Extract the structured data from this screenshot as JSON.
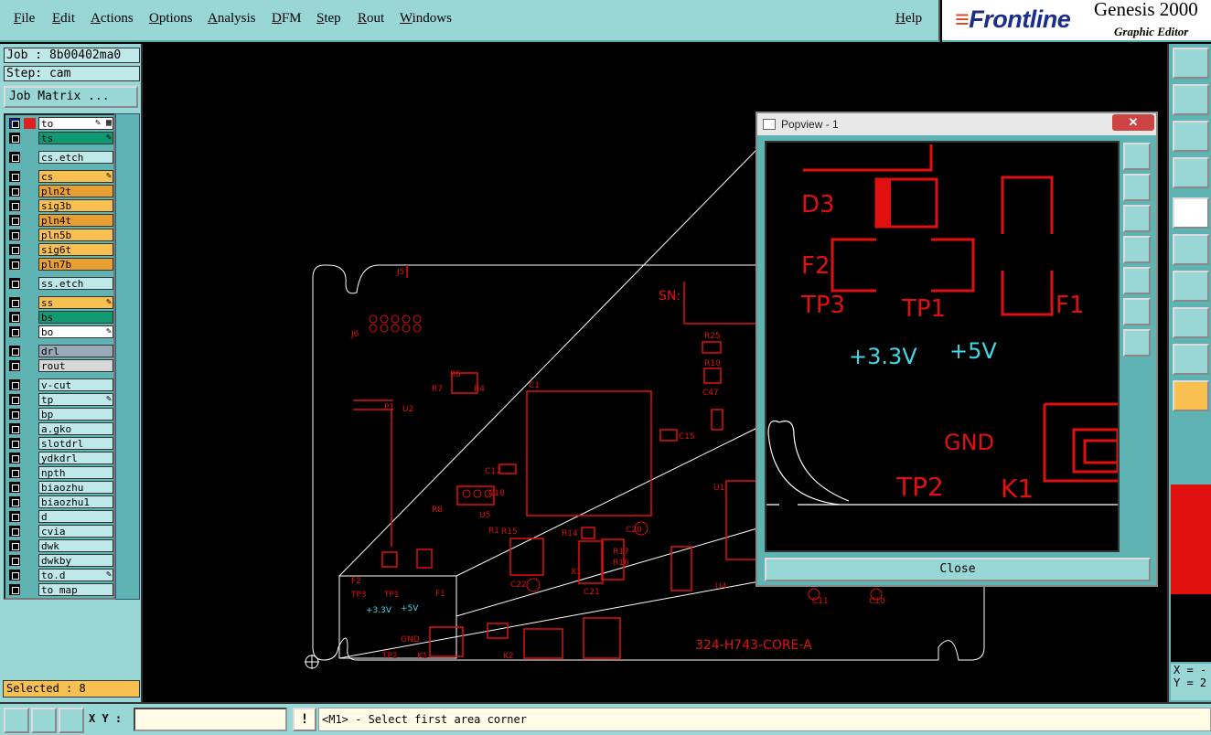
{
  "menubar": {
    "items": [
      "File",
      "Edit",
      "Actions",
      "Options",
      "Analysis",
      "DFM",
      "Step",
      "Rout",
      "Windows"
    ],
    "help": "Help"
  },
  "logo": {
    "brand": "Frontline",
    "product": "Genesis 2000",
    "subtitle": "Graphic Editor"
  },
  "job": {
    "job_line": "Job : 8b00402ma0",
    "step_line": "Step: cam",
    "matrix_button": "Job Matrix ..."
  },
  "layers": [
    {
      "name": "to",
      "color": "#ffffff",
      "flag": "✎ ▦"
    },
    {
      "name": "ts",
      "color": "#0f9a74",
      "flag": "✎"
    },
    {
      "name": "cs.etch",
      "color": "#bfe8e8",
      "flag": ""
    },
    {
      "name": "cs",
      "color": "#f8c050",
      "flag": "✎"
    },
    {
      "name": "pln2t",
      "color": "#e8a030",
      "flag": ""
    },
    {
      "name": "sig3b",
      "color": "#f8c050",
      "flag": ""
    },
    {
      "name": "pln4t",
      "color": "#e8a030",
      "flag": ""
    },
    {
      "name": "pln5b",
      "color": "#f8c050",
      "flag": ""
    },
    {
      "name": "sig6t",
      "color": "#f8c050",
      "flag": ""
    },
    {
      "name": "pln7b",
      "color": "#e8a030",
      "flag": ""
    },
    {
      "name": "ss.etch",
      "color": "#bfe8e8",
      "flag": ""
    },
    {
      "name": "ss",
      "color": "#f8c050",
      "flag": "✎"
    },
    {
      "name": "bs",
      "color": "#0f9a74",
      "flag": ""
    },
    {
      "name": "bo",
      "color": "#ffffff",
      "flag": "✎"
    },
    {
      "name": "drl",
      "color": "#9aa8b8",
      "flag": ""
    },
    {
      "name": "rout",
      "color": "#d8d8d8",
      "flag": ""
    },
    {
      "name": "v-cut",
      "color": "#bfe8e8",
      "flag": ""
    },
    {
      "name": "tp",
      "color": "#bfe8e8",
      "flag": "✎"
    },
    {
      "name": "bp",
      "color": "#bfe8e8",
      "flag": ""
    },
    {
      "name": "a.gko",
      "color": "#bfe8e8",
      "flag": ""
    },
    {
      "name": "slotdrl",
      "color": "#bfe8e8",
      "flag": ""
    },
    {
      "name": "ydkdrl",
      "color": "#bfe8e8",
      "flag": ""
    },
    {
      "name": "npth",
      "color": "#bfe8e8",
      "flag": ""
    },
    {
      "name": "biaozhu",
      "color": "#bfe8e8",
      "flag": ""
    },
    {
      "name": "biaozhu1",
      "color": "#bfe8e8",
      "flag": ""
    },
    {
      "name": "d",
      "color": "#bfe8e8",
      "flag": ""
    },
    {
      "name": "cvia",
      "color": "#bfe8e8",
      "flag": ""
    },
    {
      "name": "dwk",
      "color": "#bfe8e8",
      "flag": ""
    },
    {
      "name": "dwkby",
      "color": "#bfe8e8",
      "flag": ""
    },
    {
      "name": "to.d",
      "color": "#bfe8e8",
      "flag": "✎"
    },
    {
      "name": "to_map",
      "color": "#bfe8e8",
      "flag": ""
    }
  ],
  "selected": "Selected : 8",
  "pcb_labels": [
    "J5",
    "J6",
    "SN:",
    "R25",
    "R10",
    "C47",
    "R5",
    "R7",
    "R4",
    "C1",
    "U2",
    "P1",
    "C15",
    "C17",
    "C18",
    "R8",
    "U5",
    "R1",
    "R15",
    "R14",
    "C20",
    "U1",
    "R17",
    "R16",
    "X1",
    "C22",
    "C21",
    "U4",
    "C11",
    "C10",
    "F2",
    "TP3",
    "TP1",
    "F1",
    "+3.3V",
    "+5V",
    "GND",
    "TP2",
    "K1",
    "K2",
    "324-H743-CORE-A"
  ],
  "popview": {
    "title": "Popview - 1",
    "close_x": "✕",
    "close_button": "Close",
    "labels": {
      "d3": "D3",
      "f2": "F2",
      "tp3": "TP3",
      "tp1": "TP1",
      "f1": "F1",
      "v33": "+3.3V",
      "v5": "+5V",
      "gnd": "GND",
      "tp2": "TP2",
      "k1": "K1"
    }
  },
  "coords": {
    "x": "X = -",
    "y": "Y = 2"
  },
  "bottombar": {
    "xy_label": "X Y :",
    "xy_value": "",
    "msg_icon": "!",
    "message": "<M1> - Select first area corner"
  },
  "colors": {
    "panel": "#99d6d6",
    "copper": "#e01010",
    "silk": "#40d8e8"
  }
}
